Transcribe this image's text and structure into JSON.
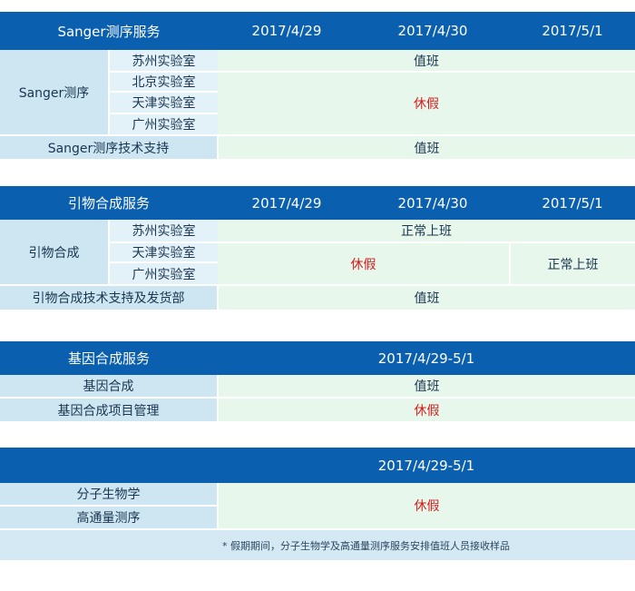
{
  "sanger": {
    "title": "Sanger测序服务",
    "dates": [
      "2017/4/29",
      "2017/4/30",
      "2017/5/1"
    ],
    "group_label": "Sanger测序",
    "labs": [
      "苏州实验室",
      "北京实验室",
      "天津实验室",
      "广州实验室"
    ],
    "status_duty": "值班",
    "status_off": "休假",
    "support_label": "Sanger测序技术支持",
    "support_status": "值班"
  },
  "primer": {
    "title": "引物合成服务",
    "dates": [
      "2017/4/29",
      "2017/4/30",
      "2017/5/1"
    ],
    "group_label": "引物合成",
    "labs": [
      "苏州实验室",
      "天津实验室",
      "广州实验室"
    ],
    "status_normal": "正常上班",
    "status_off": "休假",
    "status_normal_may1": "正常上班",
    "support_label": "引物合成技术支持及发货部",
    "support_status": "值班"
  },
  "gene": {
    "title": "基因合成服务",
    "date_range": "2017/4/29-5/1",
    "rows": [
      {
        "label": "基因合成",
        "status": "值班"
      },
      {
        "label": "基因合成项目管理",
        "status": "休假"
      }
    ]
  },
  "other": {
    "date_range": "2017/4/29-5/1",
    "rows": [
      "分子生物学",
      "高通量测序"
    ],
    "status": "休假",
    "note": "* 假期期间，分子生物学及高通量测序服务安排值班人员接收样品"
  },
  "colors": {
    "header_bg": "#0a5fae",
    "label_bg": "#cde6f2",
    "value_bg": "#e8f7ec",
    "off_text": "#d41c1c"
  }
}
